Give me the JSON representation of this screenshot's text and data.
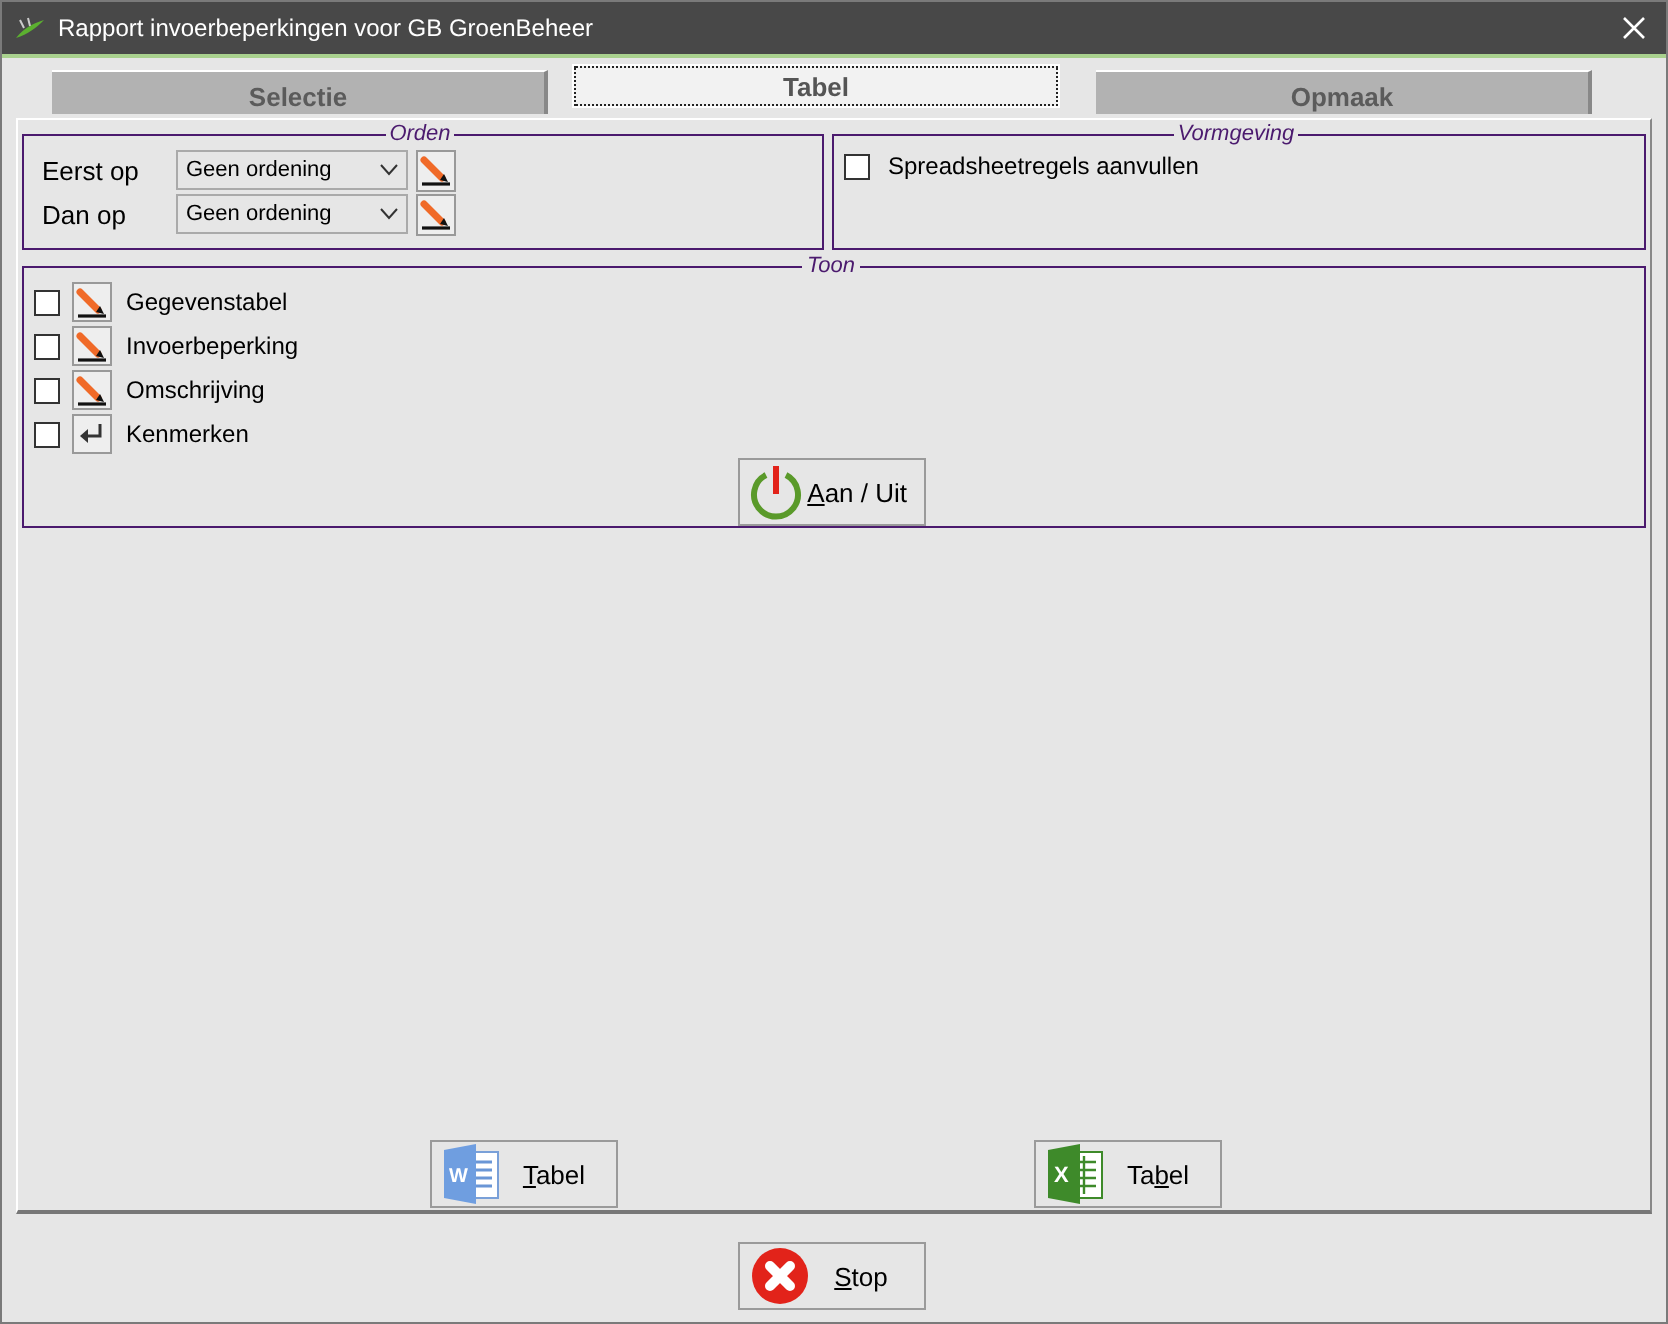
{
  "window": {
    "title": "Rapport invoerbeperkingen voor GB GroenBeheer"
  },
  "tabs": [
    {
      "label": "Selectie",
      "selected": false
    },
    {
      "label": "Tabel",
      "selected": true
    },
    {
      "label": "Opmaak",
      "selected": false
    }
  ],
  "orden": {
    "title": "Orden",
    "rows": [
      {
        "label": "Eerst op",
        "value": "Geen ordening"
      },
      {
        "label": "Dan op",
        "value": "Geen ordening"
      }
    ]
  },
  "vormgeving": {
    "title": "Vormgeving",
    "options": [
      {
        "label": "Spreadsheetregels aanvullen",
        "checked": false
      }
    ]
  },
  "toon": {
    "title": "Toon",
    "items": [
      {
        "label": "Gegevenstabel",
        "checked": false,
        "kind": "edit"
      },
      {
        "label": "Invoerbeperking",
        "checked": false,
        "kind": "edit"
      },
      {
        "label": "Omschrijving",
        "checked": false,
        "kind": "edit"
      },
      {
        "label": "Kenmerken",
        "checked": false,
        "kind": "enter"
      }
    ],
    "toggle_button": {
      "mnemonic": "A",
      "label_after": "an / Uit"
    }
  },
  "export_buttons": [
    {
      "kind": "word",
      "icon_letter": "W",
      "mnemonic": "T",
      "label_after": "abel"
    },
    {
      "kind": "excel",
      "icon_letter": "X",
      "label_before": "Ta",
      "mnemonic": "b",
      "label_after": "el"
    }
  ],
  "stop_button": {
    "mnemonic": "S",
    "label_after": "top"
  }
}
